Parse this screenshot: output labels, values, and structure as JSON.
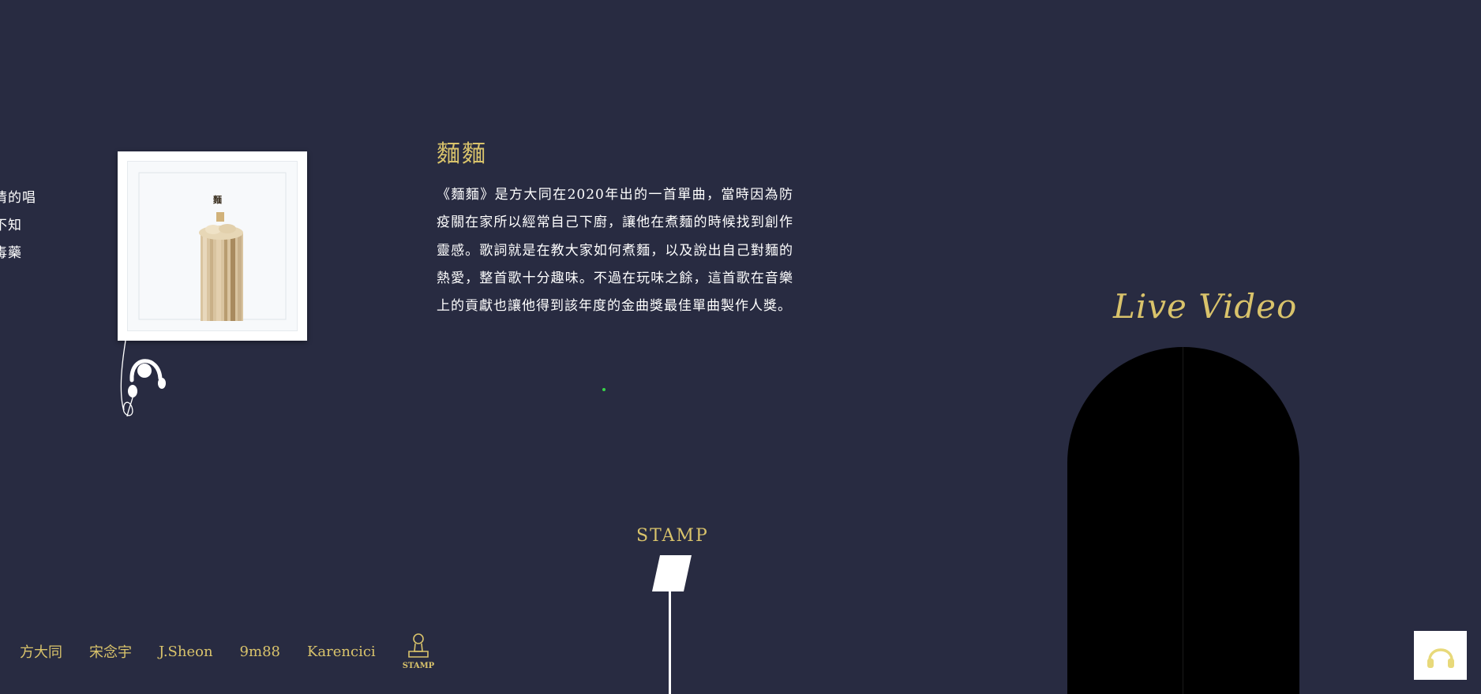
{
  "previous_panel": {
    "lines": [
      "情的唱",
      "不知",
      "毒藥"
    ]
  },
  "song": {
    "title": "麵麵",
    "description": "《麵麵》是方大同在2020年出的一首單曲，當時因為防疫關在家所以經常自己下廚，讓他在煮麵的時候找到創作靈感。歌詞就是在教大家如何煮麵，以及說出自己對麵的熱愛，整首歌十分趣味。不過在玩味之餘，這首歌在音樂上的貢獻也讓他得到該年度的金曲獎最佳單曲製作人獎。",
    "cover_text": "麵"
  },
  "stamp": {
    "label": "STAMP"
  },
  "live_video": {
    "title": "Live Video"
  },
  "nav": {
    "items": [
      "方大同",
      "宋念宇",
      "J.Sheon",
      "9m88",
      "Karencici"
    ],
    "stamp_label": "STAMP"
  },
  "colors": {
    "background": "#282b41",
    "accent_gold": "#d9c36b",
    "text": "#ffffff",
    "video": "#000000"
  },
  "icons": {
    "headphones": "headphones-icon",
    "stamp": "stamp-icon",
    "audio": "headphones-icon"
  }
}
